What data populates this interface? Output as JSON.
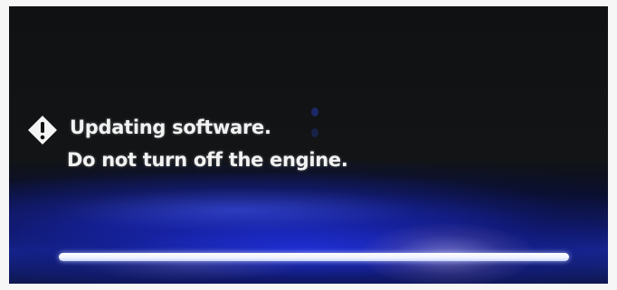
{
  "update_screen": {
    "message_line1": "Updating software.",
    "message_line2": "Do not turn off the engine.",
    "icon": "warning-diamond-icon",
    "progress": 1.0,
    "colors": {
      "text": "#f2f2f2",
      "progress_bar": "#ffffff",
      "background": "#111314",
      "glow": "#2a3cff"
    }
  }
}
